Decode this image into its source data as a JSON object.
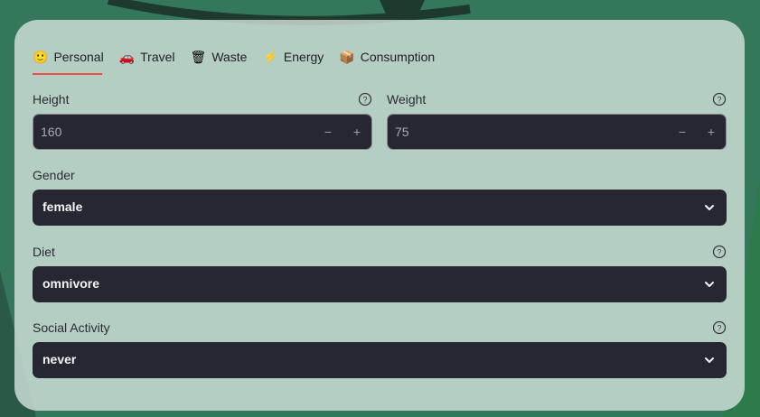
{
  "tabs": [
    {
      "icon": "🙂",
      "label": "Personal"
    },
    {
      "icon": "🚗",
      "label": "Travel"
    },
    {
      "icon": "🗑",
      "label": "Waste"
    },
    {
      "icon": "⚡",
      "label": "Energy"
    },
    {
      "icon": "📦",
      "label": "Consumption"
    }
  ],
  "fields": {
    "height": {
      "label": "Height",
      "value": "160",
      "minus": "−",
      "plus": "+"
    },
    "weight": {
      "label": "Weight",
      "value": "75",
      "minus": "−",
      "plus": "+"
    },
    "gender": {
      "label": "Gender",
      "value": "female"
    },
    "diet": {
      "label": "Diet",
      "value": "omnivore"
    },
    "social": {
      "label": "Social Activity",
      "value": "never"
    }
  },
  "colors": {
    "accent": "#f04b4b",
    "input_bg": "#262730",
    "panel_bg": "#d6e4de"
  },
  "active_tab": "Personal"
}
